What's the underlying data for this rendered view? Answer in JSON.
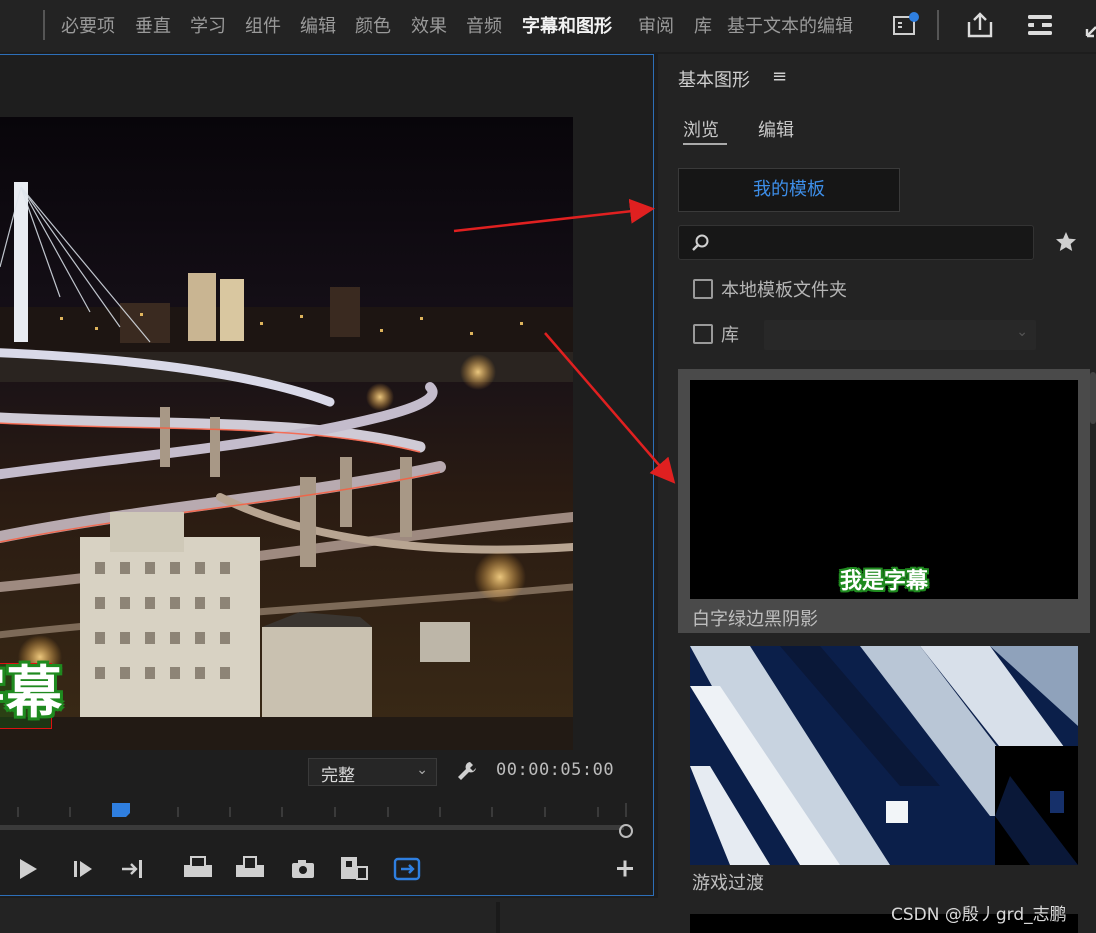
{
  "workspace_tabs": [
    "必要项",
    "垂直",
    "学习",
    "组件",
    "编辑",
    "颜色",
    "效果",
    "音频",
    "字幕和图形",
    "审阅",
    "库",
    "基于文本的编辑"
  ],
  "active_workspace": "字幕和图形",
  "monitor": {
    "subtitle_fragment": "字幕",
    "quality": "完整",
    "timecode": "00:00:05:00"
  },
  "panel": {
    "title": "基本图形",
    "menu_glyph": "≡",
    "tabs": [
      "浏览",
      "编辑"
    ],
    "my_templates": "我的模板",
    "search_placeholder": "",
    "local_folder_label": "本地模板文件夹",
    "library_label": "库",
    "library_value": "",
    "templates": [
      {
        "name": "白字绿边黑阴影",
        "caption": "我是字幕"
      },
      {
        "name": "游戏过渡",
        "caption": ""
      }
    ]
  },
  "watermark": "CSDN @殷丿grd_志鹏",
  "colors": {
    "accent": "#3d8ee8",
    "monitor_border": "#2d6fb8",
    "annotation_arrow": "#e02020",
    "subtitle_outline": "#1f8a1f"
  }
}
